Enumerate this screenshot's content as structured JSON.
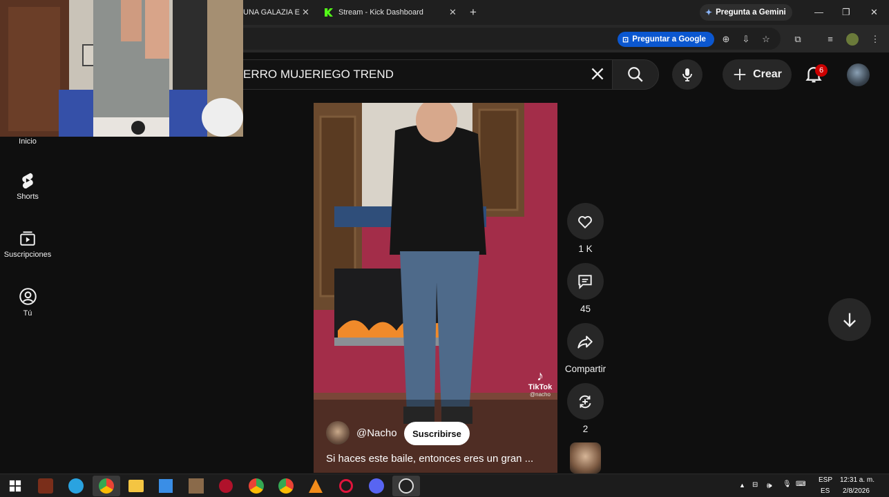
{
  "browser": {
    "tabs": [
      {
        "title": "UNA GALAZIA E"
      },
      {
        "title": "Stream - Kick Dashboard"
      }
    ],
    "gemini_label": "Pregunta a Gemini",
    "ask_google_label": "Preguntar a Google"
  },
  "youtube": {
    "search_query": "ERRO MUJERIEGO TREND",
    "create_label": "Crear",
    "notification_count": "6",
    "sidebar": [
      {
        "label": "Inicio"
      },
      {
        "label": "Shorts"
      },
      {
        "label": "Suscripciones"
      },
      {
        "label": "Tú"
      }
    ],
    "short": {
      "channel": "@Nacho",
      "subscribe_label": "Suscribirse",
      "caption": "Si haces este baile, entonces eres un gran ...",
      "watermark": "TikTok",
      "watermark_handle": "@nacho"
    },
    "actions": {
      "likes": "1 K",
      "comments": "45",
      "share_label": "Compartir",
      "remix_count": "2"
    }
  },
  "taskbar": {
    "lang_top": "ESP",
    "lang_bottom": "ES",
    "time": "12:31 a. m.",
    "date": "2/8/2026"
  },
  "colors": {
    "background": "#0f0f0f",
    "accent_red": "#cc0000",
    "ask_google_blue": "#0b57d0",
    "kick_green": "#53fc18"
  }
}
